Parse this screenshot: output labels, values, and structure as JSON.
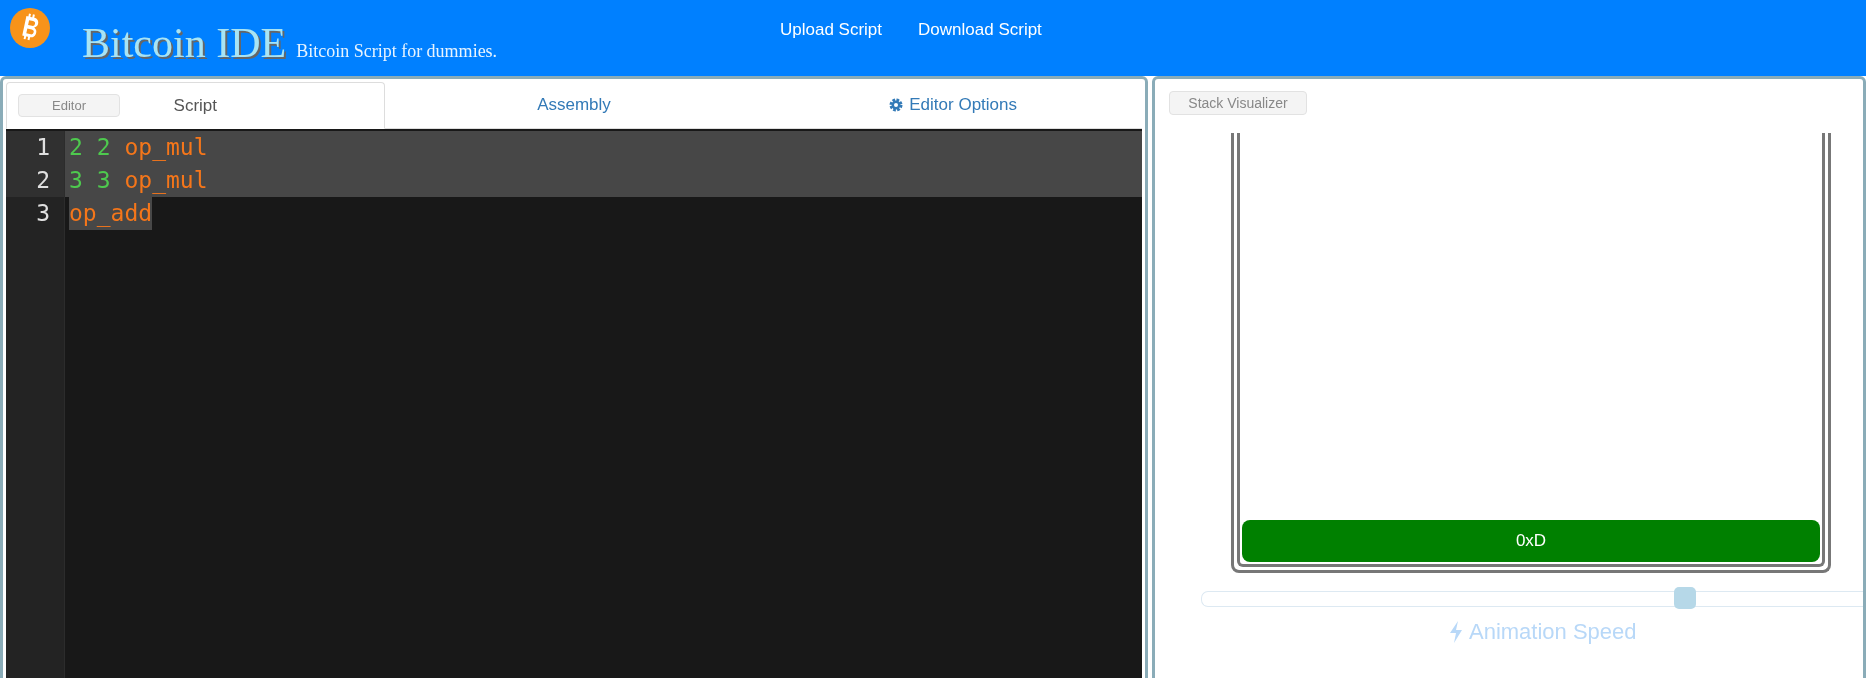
{
  "header": {
    "title": "Bitcoin IDE",
    "subtitle": "Bitcoin Script for dummies.",
    "nav": [
      "Upload Script",
      "Download Script"
    ]
  },
  "editor": {
    "badge": "Editor",
    "tabs": [
      {
        "label": "Script",
        "selected": true,
        "kind": "plain"
      },
      {
        "label": "Assembly",
        "selected": false,
        "kind": "plain"
      },
      {
        "label": "Editor Options",
        "selected": false,
        "kind": "options"
      }
    ],
    "lines": [
      {
        "number": "1",
        "kind": "row",
        "tokens": [
          {
            "text": "2",
            "kind": "number"
          },
          {
            "text": "2",
            "kind": "number"
          },
          {
            "text": "op_mul",
            "kind": "opcode"
          }
        ]
      },
      {
        "number": "2",
        "kind": "row",
        "tokens": [
          {
            "text": "3",
            "kind": "number"
          },
          {
            "text": "3",
            "kind": "number"
          },
          {
            "text": "op_mul",
            "kind": "opcode"
          }
        ]
      },
      {
        "number": "3",
        "kind": "text",
        "tokens": [
          {
            "text": "op_add",
            "kind": "opcode"
          }
        ]
      }
    ]
  },
  "stack": {
    "badge": "Stack Visualizer",
    "items": [
      {
        "value": "0xD",
        "color": "#008000"
      }
    ],
    "speed": {
      "level": 0.73,
      "label": "Animation Speed"
    }
  }
}
